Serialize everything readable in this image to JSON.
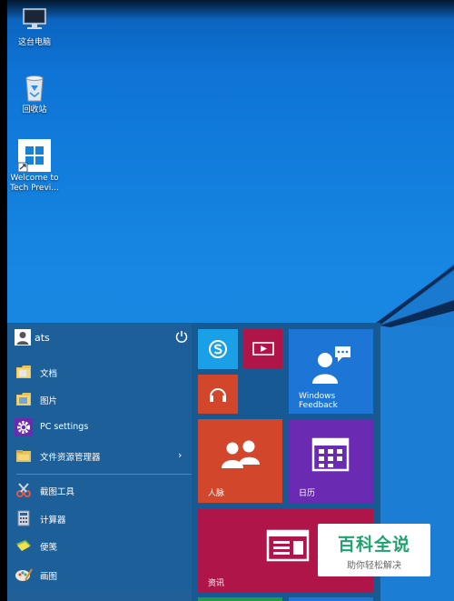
{
  "desktop": {
    "icons": [
      {
        "label": "这台电脑",
        "icon": "computer-icon"
      },
      {
        "label": "回收站",
        "icon": "recycle-bin-icon"
      },
      {
        "label_line1": "Welcome to",
        "label_line2": "Tech Previ...",
        "icon": "windows-logo-icon"
      }
    ]
  },
  "start_menu": {
    "user_name": "ats",
    "items": [
      {
        "label": "文档",
        "icon": "folder-icon"
      },
      {
        "label": "图片",
        "icon": "folder-icon"
      },
      {
        "label": "PC settings",
        "icon": "gear-icon"
      },
      {
        "label": "文件资源管理器",
        "icon": "file-explorer-icon"
      },
      {
        "label": "截图工具",
        "icon": "snipping-tool-icon"
      },
      {
        "label": "计算器",
        "icon": "calculator-icon"
      },
      {
        "label": "便笺",
        "icon": "sticky-notes-icon"
      },
      {
        "label": "画图",
        "icon": "paint-icon"
      }
    ],
    "tiles": [
      {
        "label": "",
        "icon": "skype-icon",
        "color": "#1aa0e6"
      },
      {
        "label": "",
        "icon": "video-icon",
        "color": "#b0154a"
      },
      {
        "label": "",
        "icon": "headphones-icon",
        "color": "#d2472c"
      },
      {
        "label_line1": "Windows",
        "label_line2": "Feedback",
        "icon": "feedback-icon",
        "color": "#1d75d6"
      },
      {
        "label": "人脉",
        "icon": "people-icon",
        "color": "#d2472c"
      },
      {
        "label": "日历",
        "icon": "calendar-icon",
        "color": "#6a2bb2"
      },
      {
        "label": "资讯",
        "icon": "news-icon",
        "color": "#b0154a"
      }
    ]
  },
  "watermark": {
    "title": "百科全说",
    "subtitle": "助你轻松解决"
  }
}
